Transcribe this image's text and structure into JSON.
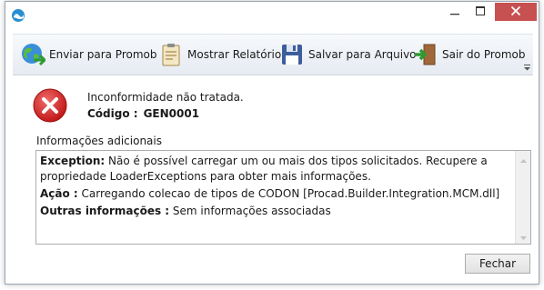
{
  "window": {
    "app_icon": "wave-logo-icon",
    "controls": {
      "minimize": "minimize-icon",
      "maximize": "maximize-icon",
      "close": "close-icon"
    }
  },
  "toolbar": {
    "items": [
      {
        "label": "Enviar para Promob",
        "icon": "globe-send-icon"
      },
      {
        "label": "Mostrar Relatório",
        "icon": "clipboard-report-icon"
      },
      {
        "label": "Salvar para Arquivo",
        "icon": "floppy-disk-icon"
      },
      {
        "label": "Sair do Promob",
        "icon": "exit-door-icon"
      }
    ],
    "overflow_icon": "overflow-chevron-icon"
  },
  "error": {
    "icon": "error-x-icon",
    "message": "Inconformidade não tratada.",
    "code_label": "Código :",
    "code_value": "GEN0001"
  },
  "info": {
    "section_label": "Informações adicionais",
    "exception_label": "Exception:",
    "exception_text": "Não é possível carregar um ou mais dos tipos solicitados. Recupere a propriedade LoaderExceptions para obter mais informações.",
    "action_label": "Ação :",
    "action_text": "Carregando colecao de tipos de CODON [Procad.Builder.Integration.MCM.dll]",
    "other_label": "Outras informações :",
    "other_text": "Sem informações associadas"
  },
  "buttons": {
    "close_label": "Fechar"
  },
  "colors": {
    "close_button": "#c75050",
    "error_red": "#d42020",
    "toolbar_top": "#f7f9fc",
    "toolbar_bottom": "#e6ebf2"
  }
}
